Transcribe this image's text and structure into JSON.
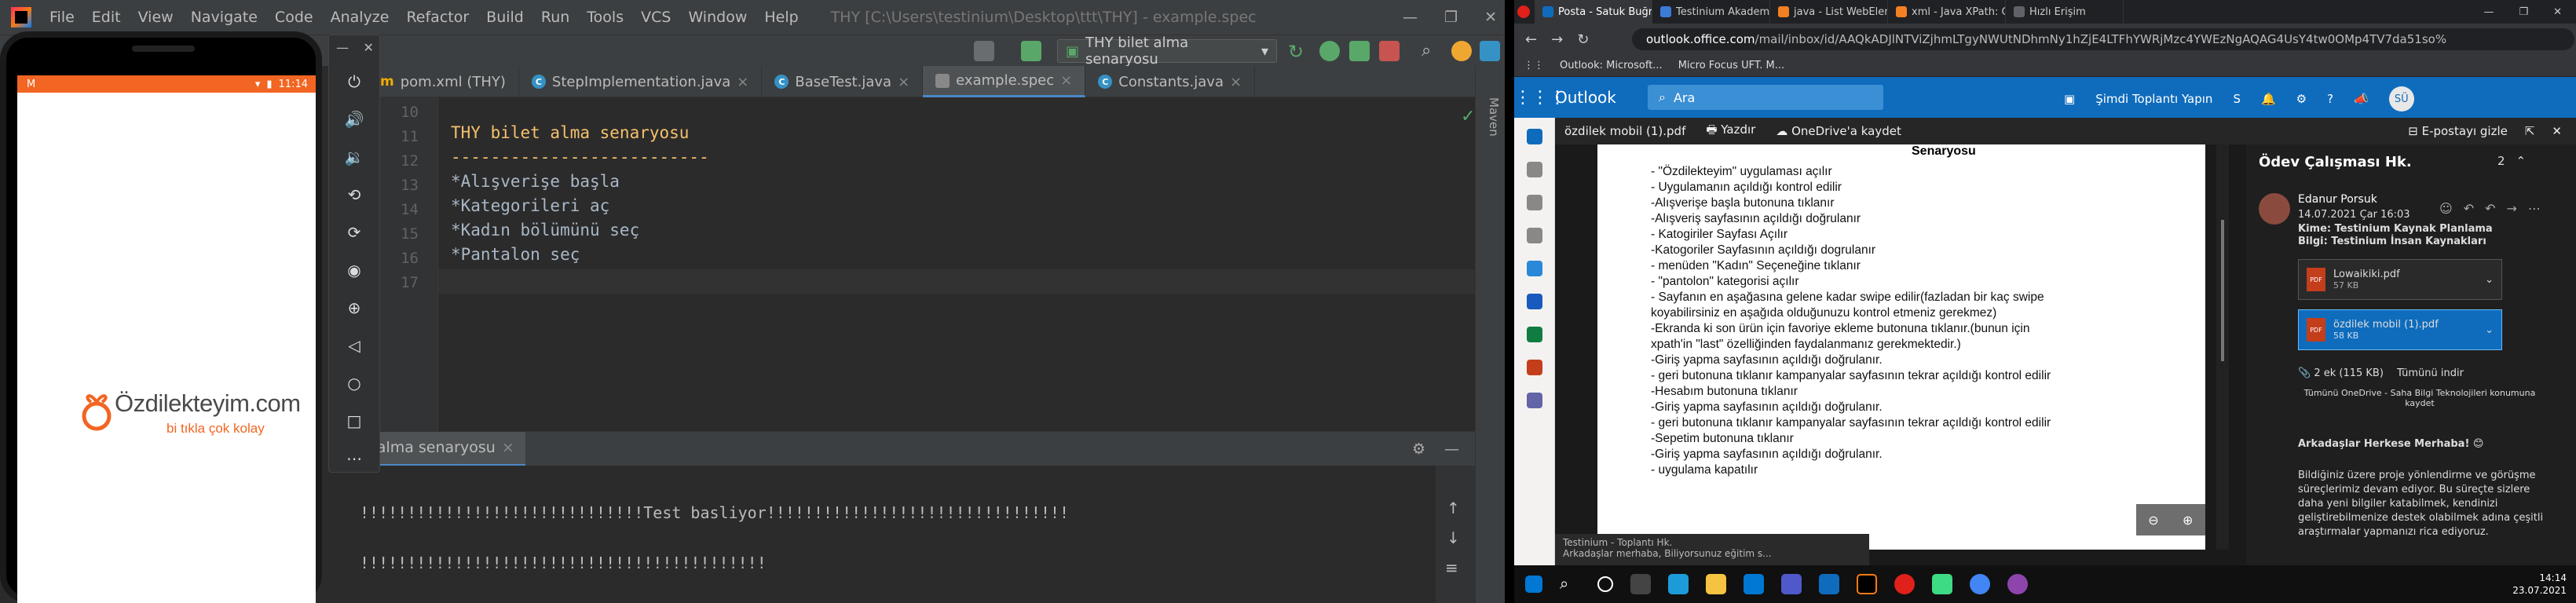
{
  "ide": {
    "menu": [
      "File",
      "Edit",
      "View",
      "Navigate",
      "Code",
      "Analyze",
      "Refactor",
      "Build",
      "Run",
      "Tools",
      "VCS",
      "Window",
      "Help"
    ],
    "title": "THY [C:\\Users\\testinium\\Desktop\\ttt\\THY] - example.spec",
    "window_controls": [
      "—",
      "❐",
      "✕"
    ],
    "run_config": "THY bilet alma senaryosu",
    "tabs": [
      {
        "label": "pom.xml (THY)",
        "icon": "maven-icon"
      },
      {
        "label": "StepImplementation.java",
        "icon": "class-icon"
      },
      {
        "label": "BaseTest.java",
        "icon": "class-icon"
      },
      {
        "label": "example.spec",
        "icon": "spec-icon",
        "active": true
      },
      {
        "label": "Constants.java",
        "icon": "class-icon"
      }
    ],
    "line_numbers": [
      "10",
      "11",
      "12",
      "13",
      "14",
      "15",
      "16",
      "17"
    ],
    "code": {
      "heading": "THY bilet alma senaryosu",
      "underline": "--------------------------",
      "step1": "*Alışverişe başla",
      "step2": "*Kategorileri aç",
      "step3": "*Kadın bölümünü seç",
      "step4": "*Pantalon seç"
    },
    "maven_label": "Maven",
    "run_tab": "bilet alma senaryosu",
    "console": [
      "!!!!!!!!!!!!!!!!!!!!!!!!!!!!!!Test basliyor!!!!!!!!!!!!!!!!!!!!!!!!!!!!!!!!",
      "",
      "!!!!!!!!!!!!!!!!!!!!!!!!!!!!!!!!!!!!!!!!!!!"
    ]
  },
  "phone": {
    "status_left": "M",
    "status_right": "11:14",
    "brand": "Özdilekteyim.com",
    "tagline": "bi tıkla çok kolay",
    "brand_color": "#f26522"
  },
  "emulator_controls": {
    "minimize": "—",
    "close": "✕",
    "buttons": [
      "power-icon",
      "volume-up-icon",
      "volume-down-icon",
      "rotate-left-icon",
      "rotate-right-icon",
      "camera-icon",
      "zoom-icon",
      "back-icon",
      "home-icon",
      "overview-icon",
      "more-icon"
    ]
  },
  "chrome": {
    "tabs": [
      "Posta - Satuk Buğra Üçkuş",
      "Testinium Akademi | Screen...",
      "java - List WebElement ak...",
      "xml - Java XPath: Get all the...",
      "Hızlı Erişim"
    ],
    "url_host": "outlook.office.com",
    "url_path": "/mail/inbox/id/AAQkADJlNTViZjhmLTgyNWUtNDhmNy1hZjE4LTFhYWRjMzc4YWEzNgAQAG4UsY4tw0OMp4TV7da51so%",
    "bookmarks": [
      "Outlook: Microsoft...",
      "Micro Focus UFT. M..."
    ]
  },
  "outlook": {
    "app": "Outlook",
    "search_placeholder": "Ara",
    "meeting": "Şimdi Toplantı Yapın",
    "user_initials": "SÜ",
    "viewer": {
      "file": "özdilek mobil (1).pdf",
      "print": "Yazdır",
      "save": "OneDrive'a kaydet",
      "hide": "E-postayı gizle"
    },
    "pdf": {
      "title": "Senaryosu",
      "lines": [
        "- \"Özdilekteyim\" uygulaması açılır",
        "- Uygulamanın açıldığı kontrol edilir",
        "-Alışverişe başla butonuna tıklanır",
        "-Alışveriş sayfasının açıldığı doğrulanır",
        "- Katogiriler Sayfası Açılır",
        "-Katogoriler Sayfasının açıldığı dogrulanır",
        "- menüden \"Kadın\" Seçeneğine tıklanır",
        "- \"pantolon\" kategorisi açılır",
        "- Sayfanın en aşağasına gelene kadar swipe edilir(fazladan bir kaç swipe",
        "koyabilirsiniz en aşağıda olduğunuzu kontrol etmeniz gerekmez)",
        "-Ekranda ki son ürün için favoriye ekleme butonuna tıklanır.(bunun için",
        "xpath'in \"last\" özelliğinden faydalanmanız gerekmektedir.)",
        "-Giriş yapma sayfasının açıldığı doğrulanır.",
        "- geri butonuna tıklanır kampanyalar sayfasının tekrar açıldığı kontrol edilir",
        "-Hesabım butonuna tıklanır",
        "-Giriş yapma sayfasının açıldığı doğrulanır.",
        "- geri butonuna tıklanır kampanyalar sayfasının tekrar açıldığı kontrol edilir",
        "-Sepetim butonuna tıklanır",
        "-Giriş yapma sayfasının açıldığı doğrulanır.",
        "- uygulama kapatılır"
      ],
      "zoom_out": "⊖",
      "zoom_in": "⊕",
      "more": "⋯"
    },
    "reading": {
      "subject": "Ödev Çalışması Hk.",
      "count": "2",
      "sender": "Edanur Porsuk",
      "date": "14.07.2021 Çar 16:03",
      "to": "Kime: Testinium Kaynak Planlama",
      "cc": "Bilgi: Testinium İnsan Kaynakları",
      "attachments": [
        {
          "name": "Lowaikiki.pdf",
          "size": "57 KB"
        },
        {
          "name": "özdilek mobil (1).pdf",
          "size": "58 KB",
          "selected": true
        }
      ],
      "att_summary": "2 ek (115 KB)",
      "download_all": "Tümünü indir",
      "save_all": "Tümünü OneDrive - Saha Bilgi Teknolojileri konumuna kaydet",
      "greeting": "Arkadaşlar Herkese Merhaba! 😊",
      "body": [
        "Bildiğiniz üzere proje yönlendirme ve görüşme",
        "süreçlerimiz devam ediyor. Bu süreçte sizlere",
        "daha yeni bilgiler katabilmek, kendinizi",
        "geliştirebilmenize destek olabilmek adına çeşitli",
        "araştırmalar yapmanızı rica ediyoruz."
      ]
    },
    "notification": [
      "Testinium - Toplantı Hk.",
      "Arkadaşlar merhaba, Biliyorsunuz eğitim s..."
    ]
  },
  "taskbar": {
    "time": "14:14",
    "date": "23.07.2021"
  }
}
